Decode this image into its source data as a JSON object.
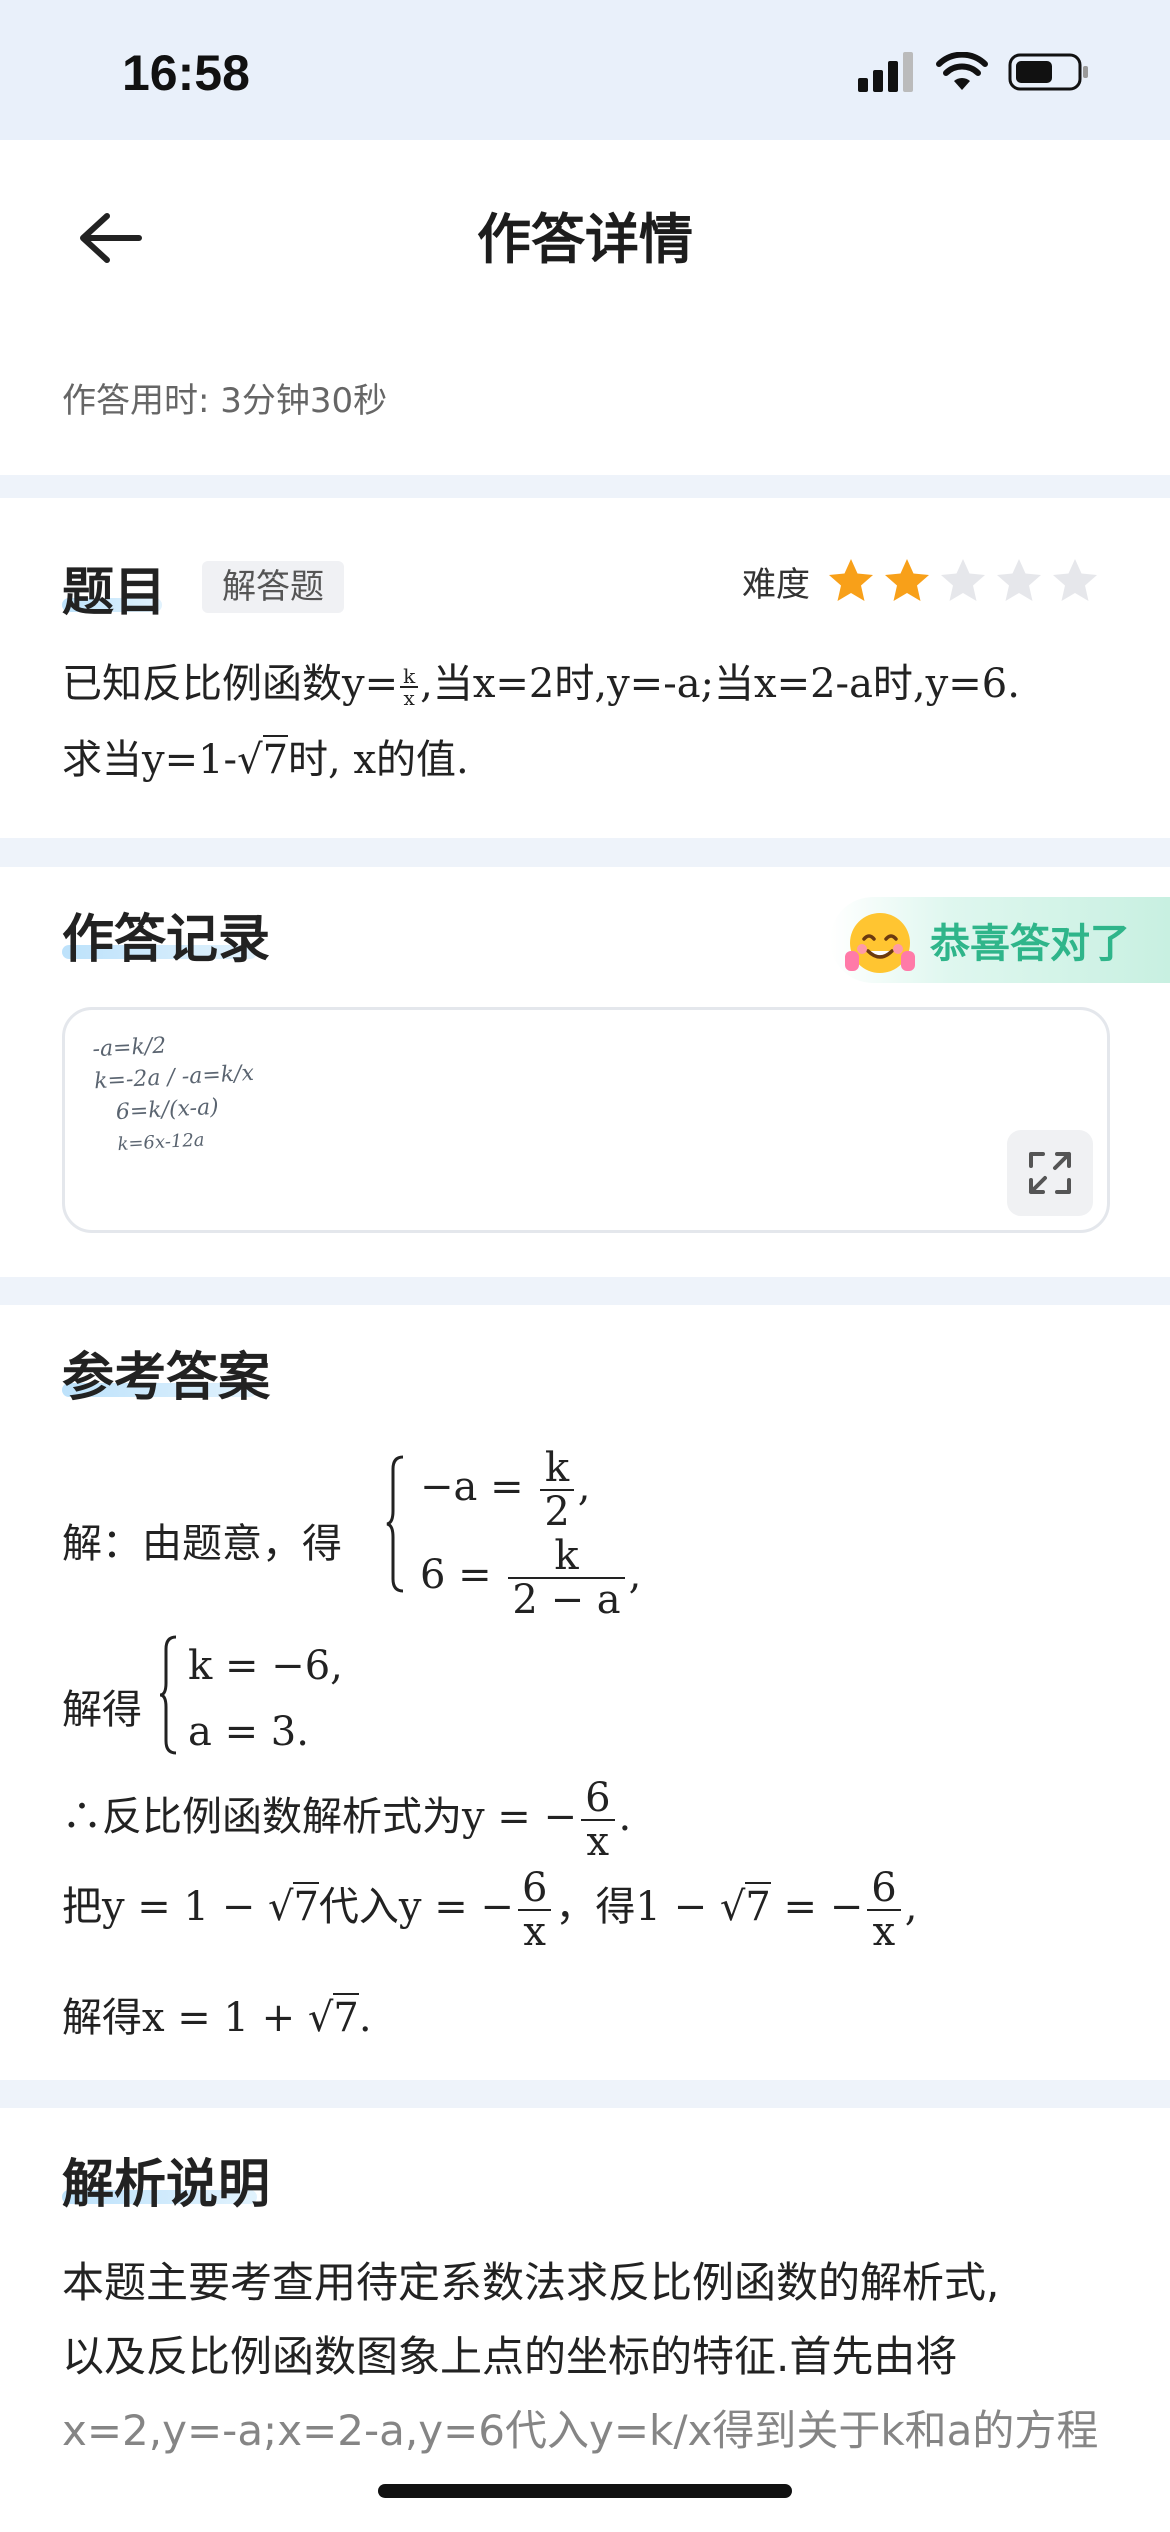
{
  "status_bar": {
    "time": "16:58"
  },
  "header": {
    "title": "作答详情"
  },
  "answer_time": "作答用时: 3分钟30秒",
  "question": {
    "section_title": "题目",
    "type_tag": "解答题",
    "difficulty_label": "难度",
    "difficulty_stars": 2,
    "difficulty_max": 5,
    "line1_a": "已知反比例函数y=",
    "frac_num": "k",
    "frac_den": "x",
    "line1_b": ",当x=2时,y=-a;当x=2-a时,y=6.",
    "line2_a": "求当y=1-",
    "line2_sqrt": "7",
    "line2_b": "时, x的值."
  },
  "record": {
    "section_title": "作答记录",
    "badge_text": "恭喜答对了",
    "handwriting": [
      "-a=k/2",
      "k=-2a  / -a=k/x",
      "6=k/(x-a)",
      "k=6x-12a"
    ]
  },
  "reference": {
    "section_title": "参考答案",
    "solve_prefix": "解：由题意，得",
    "sys1_eq1_lhs": "−a =",
    "sys1_eq1_num": "k",
    "sys1_eq1_den": "2",
    "sys1_eq2_lhs": "6 =",
    "sys1_eq2_num": "k",
    "sys1_eq2_den": "2 − a",
    "comma": ",",
    "get_prefix": "解得",
    "sys2_eq1": "k = −6,",
    "sys2_eq2": "a = 3.",
    "line3_a": "∴反比例函数解析式为y = −",
    "line3_num": "6",
    "line3_den": "x",
    "line3_b": ".",
    "line4_a": "把y = 1 − ",
    "line4_sqrt": "7",
    "line4_b": "代入y = −",
    "line4_num": "6",
    "line4_den": "x",
    "line4_c": "，得1 − ",
    "line4_sqrt2": "7",
    "line4_d": " = −",
    "line4_num2": "6",
    "line4_den2": "x",
    "line4_e": ",",
    "line5_a": "解得x = 1 + ",
    "line5_sqrt": "7",
    "line5_b": "."
  },
  "explanation": {
    "section_title": "解析说明",
    "line1": "本题主要考查用待定系数法求反比例函数的解析式,",
    "line2": "以及反比例函数图象上点的坐标的特征.首先由将",
    "line3": "x=2,y=-a;x=2-a,y=6代入y=k/x得到关于k和a的方程"
  },
  "colors": {
    "accent": "#2fb58a",
    "star_active": "#f8a019",
    "star_inactive": "#e6e7eb",
    "underline": "#bde2fb"
  }
}
